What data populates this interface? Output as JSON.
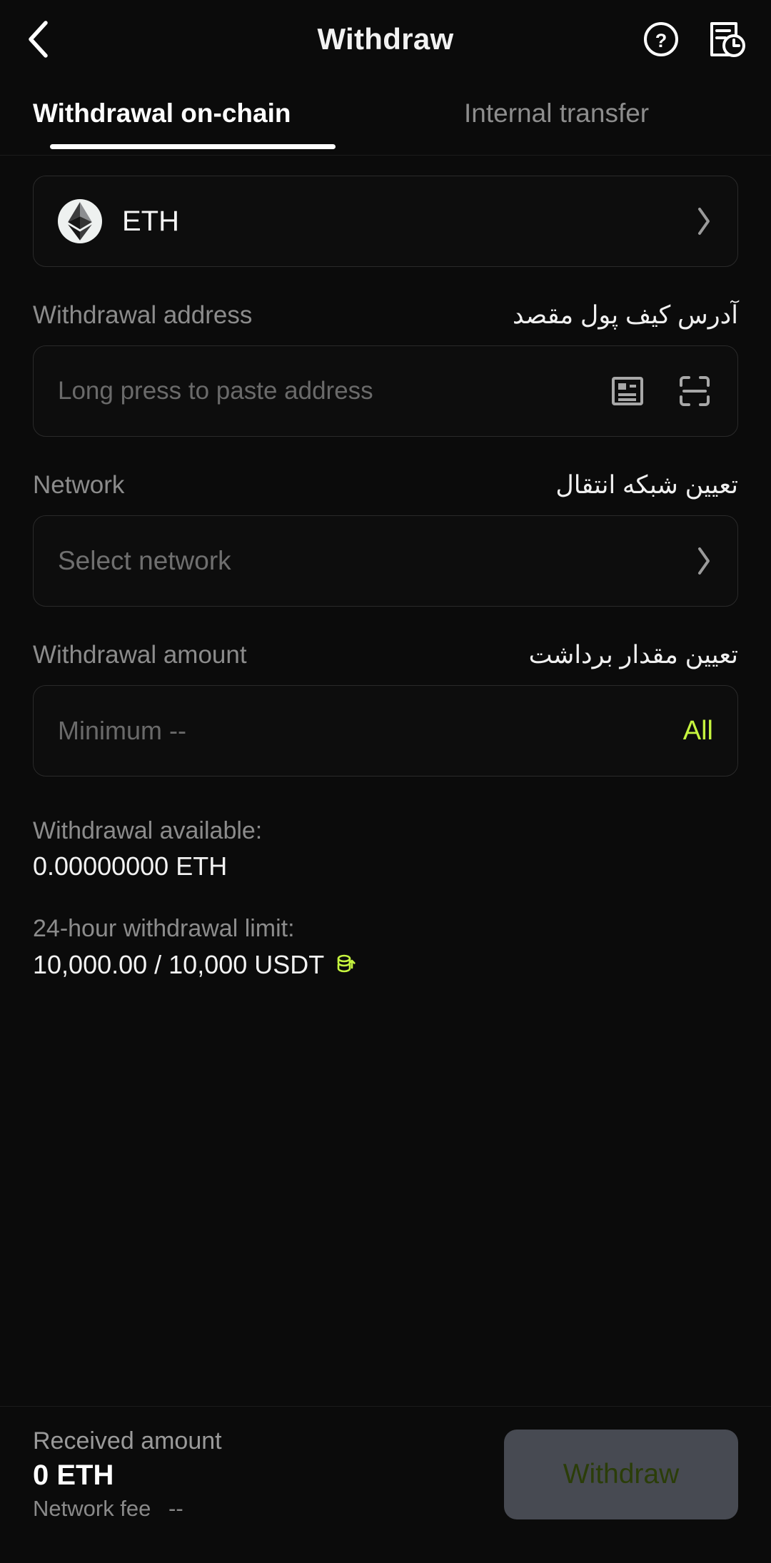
{
  "header": {
    "title": "Withdraw",
    "back_icon": "chevron-left-icon",
    "help_icon": "question-circle-icon",
    "history_icon": "records-clock-icon"
  },
  "tabs": [
    {
      "label": "Withdrawal on-chain",
      "active": true
    },
    {
      "label": "Internal transfer",
      "active": false
    }
  ],
  "coin_selector": {
    "symbol": "ETH",
    "logo_icon": "ethereum-icon",
    "chevron_icon": "chevron-right-icon"
  },
  "address_section": {
    "label_en": "Withdrawal address",
    "label_fa": "آدرس کیف پول مقصد",
    "placeholder": "Long press to paste address",
    "value": "",
    "addressbook_icon": "address-book-icon",
    "scan_icon": "qr-scan-icon"
  },
  "network_section": {
    "label_en": "Network",
    "label_fa": "تعیین شبکه انتقال",
    "placeholder": "Select network",
    "value": "",
    "chevron_icon": "chevron-right-icon"
  },
  "amount_section": {
    "label_en": "Withdrawal amount",
    "label_fa": "تعیین مقدار برداشت",
    "placeholder": "Minimum --",
    "value": "",
    "all_label": "All"
  },
  "info": {
    "available_label": "Withdrawal available:",
    "available_value": "0.00000000  ETH",
    "limit_label": "24-hour withdrawal limit:",
    "limit_value": "10,000.00 / 10,000 USDT",
    "limit_icon": "increase-limit-coins-icon"
  },
  "bottom": {
    "received_label": "Received amount",
    "received_value": "0 ETH",
    "fee_label": "Network fee",
    "fee_value": "--",
    "withdraw_label": "Withdraw"
  },
  "colors": {
    "background": "#0b0b0b",
    "accent_green": "#c6f53f",
    "button_disabled_bg": "#474a52",
    "button_disabled_text": "#2b3d09",
    "muted_text": "#8c8c8c",
    "border": "#2a2a2a"
  }
}
